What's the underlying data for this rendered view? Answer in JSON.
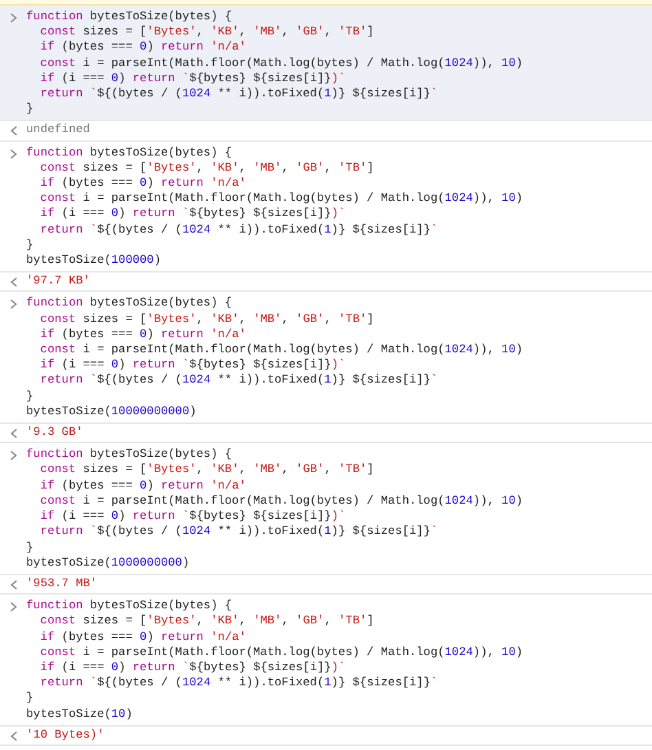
{
  "console": [
    {
      "input": {
        "selected": true,
        "lines": [
          {
            "indented": false,
            "tokens": [
              {
                "kind": "keyword",
                "text": "function"
              },
              {
                "kind": "plain",
                "text": " bytesToSize(bytes) {"
              }
            ]
          },
          {
            "indented": true,
            "tokens": [
              {
                "kind": "keyword",
                "text": "const"
              },
              {
                "kind": "plain",
                "text": " sizes = ["
              },
              {
                "kind": "string",
                "text": "'Bytes'"
              },
              {
                "kind": "plain",
                "text": ", "
              },
              {
                "kind": "string",
                "text": "'KB'"
              },
              {
                "kind": "plain",
                "text": ", "
              },
              {
                "kind": "string",
                "text": "'MB'"
              },
              {
                "kind": "plain",
                "text": ", "
              },
              {
                "kind": "string",
                "text": "'GB'"
              },
              {
                "kind": "plain",
                "text": ", "
              },
              {
                "kind": "string",
                "text": "'TB'"
              },
              {
                "kind": "plain",
                "text": "]"
              }
            ]
          },
          {
            "indented": true,
            "tokens": [
              {
                "kind": "keyword",
                "text": "if"
              },
              {
                "kind": "plain",
                "text": " (bytes === "
              },
              {
                "kind": "number",
                "text": "0"
              },
              {
                "kind": "plain",
                "text": ") "
              },
              {
                "kind": "keyword",
                "text": "return"
              },
              {
                "kind": "string",
                "text": " 'n/a'"
              }
            ]
          },
          {
            "indented": true,
            "tokens": [
              {
                "kind": "keyword",
                "text": "const"
              },
              {
                "kind": "plain",
                "text": " i = parseInt(Math.floor(Math.log(bytes) / Math.log("
              },
              {
                "kind": "number",
                "text": "1024"
              },
              {
                "kind": "plain",
                "text": ")), "
              },
              {
                "kind": "number",
                "text": "10"
              },
              {
                "kind": "plain",
                "text": ")"
              }
            ]
          },
          {
            "indented": true,
            "tokens": [
              {
                "kind": "keyword",
                "text": "if"
              },
              {
                "kind": "plain",
                "text": " (i === "
              },
              {
                "kind": "number",
                "text": "0"
              },
              {
                "kind": "plain",
                "text": ") "
              },
              {
                "kind": "keyword",
                "text": "return"
              },
              {
                "kind": "string",
                "text": " `"
              },
              {
                "kind": "plain",
                "text": "${bytes} ${sizes[i]}"
              },
              {
                "kind": "string",
                "text": ")`"
              }
            ]
          },
          {
            "indented": true,
            "tokens": [
              {
                "kind": "keyword",
                "text": "return"
              },
              {
                "kind": "string",
                "text": " `"
              },
              {
                "kind": "plain",
                "text": "${(bytes / ("
              },
              {
                "kind": "number",
                "text": "1024"
              },
              {
                "kind": "plain",
                "text": " ** i)).toFixed("
              },
              {
                "kind": "number",
                "text": "1"
              },
              {
                "kind": "plain",
                "text": ")} ${sizes[i]}"
              },
              {
                "kind": "string",
                "text": "`"
              }
            ]
          },
          {
            "indented": false,
            "tokens": [
              {
                "kind": "plain",
                "text": "}"
              }
            ]
          }
        ]
      },
      "output": {
        "kind": "undefined",
        "text": "undefined"
      }
    },
    {
      "input": {
        "selected": false,
        "lines": [
          {
            "indented": false,
            "tokens": [
              {
                "kind": "keyword",
                "text": "function"
              },
              {
                "kind": "plain",
                "text": " bytesToSize(bytes) {"
              }
            ]
          },
          {
            "indented": true,
            "tokens": [
              {
                "kind": "keyword",
                "text": "const"
              },
              {
                "kind": "plain",
                "text": " sizes = ["
              },
              {
                "kind": "string",
                "text": "'Bytes'"
              },
              {
                "kind": "plain",
                "text": ", "
              },
              {
                "kind": "string",
                "text": "'KB'"
              },
              {
                "kind": "plain",
                "text": ", "
              },
              {
                "kind": "string",
                "text": "'MB'"
              },
              {
                "kind": "plain",
                "text": ", "
              },
              {
                "kind": "string",
                "text": "'GB'"
              },
              {
                "kind": "plain",
                "text": ", "
              },
              {
                "kind": "string",
                "text": "'TB'"
              },
              {
                "kind": "plain",
                "text": "]"
              }
            ]
          },
          {
            "indented": true,
            "tokens": [
              {
                "kind": "keyword",
                "text": "if"
              },
              {
                "kind": "plain",
                "text": " (bytes === "
              },
              {
                "kind": "number",
                "text": "0"
              },
              {
                "kind": "plain",
                "text": ") "
              },
              {
                "kind": "keyword",
                "text": "return"
              },
              {
                "kind": "string",
                "text": " 'n/a'"
              }
            ]
          },
          {
            "indented": true,
            "tokens": [
              {
                "kind": "keyword",
                "text": "const"
              },
              {
                "kind": "plain",
                "text": " i = parseInt(Math.floor(Math.log(bytes) / Math.log("
              },
              {
                "kind": "number",
                "text": "1024"
              },
              {
                "kind": "plain",
                "text": ")), "
              },
              {
                "kind": "number",
                "text": "10"
              },
              {
                "kind": "plain",
                "text": ")"
              }
            ]
          },
          {
            "indented": true,
            "tokens": [
              {
                "kind": "keyword",
                "text": "if"
              },
              {
                "kind": "plain",
                "text": " (i === "
              },
              {
                "kind": "number",
                "text": "0"
              },
              {
                "kind": "plain",
                "text": ") "
              },
              {
                "kind": "keyword",
                "text": "return"
              },
              {
                "kind": "string",
                "text": " `"
              },
              {
                "kind": "plain",
                "text": "${bytes} ${sizes[i]}"
              },
              {
                "kind": "string",
                "text": ")`"
              }
            ]
          },
          {
            "indented": true,
            "tokens": [
              {
                "kind": "keyword",
                "text": "return"
              },
              {
                "kind": "string",
                "text": " `"
              },
              {
                "kind": "plain",
                "text": "${(bytes / ("
              },
              {
                "kind": "number",
                "text": "1024"
              },
              {
                "kind": "plain",
                "text": " ** i)).toFixed("
              },
              {
                "kind": "number",
                "text": "1"
              },
              {
                "kind": "plain",
                "text": ")} ${sizes[i]}"
              },
              {
                "kind": "string",
                "text": "`"
              }
            ]
          },
          {
            "indented": false,
            "tokens": [
              {
                "kind": "plain",
                "text": "}"
              }
            ]
          },
          {
            "indented": false,
            "tokens": [
              {
                "kind": "plain",
                "text": "bytesToSize("
              },
              {
                "kind": "number",
                "text": "100000"
              },
              {
                "kind": "plain",
                "text": ")"
              }
            ]
          }
        ]
      },
      "output": {
        "kind": "string",
        "text": "'97.7 KB'"
      }
    },
    {
      "input": {
        "selected": false,
        "lines": [
          {
            "indented": false,
            "tokens": [
              {
                "kind": "keyword",
                "text": "function"
              },
              {
                "kind": "plain",
                "text": " bytesToSize(bytes) {"
              }
            ]
          },
          {
            "indented": true,
            "tokens": [
              {
                "kind": "keyword",
                "text": "const"
              },
              {
                "kind": "plain",
                "text": " sizes = ["
              },
              {
                "kind": "string",
                "text": "'Bytes'"
              },
              {
                "kind": "plain",
                "text": ", "
              },
              {
                "kind": "string",
                "text": "'KB'"
              },
              {
                "kind": "plain",
                "text": ", "
              },
              {
                "kind": "string",
                "text": "'MB'"
              },
              {
                "kind": "plain",
                "text": ", "
              },
              {
                "kind": "string",
                "text": "'GB'"
              },
              {
                "kind": "plain",
                "text": ", "
              },
              {
                "kind": "string",
                "text": "'TB'"
              },
              {
                "kind": "plain",
                "text": "]"
              }
            ]
          },
          {
            "indented": true,
            "tokens": [
              {
                "kind": "keyword",
                "text": "if"
              },
              {
                "kind": "plain",
                "text": " (bytes === "
              },
              {
                "kind": "number",
                "text": "0"
              },
              {
                "kind": "plain",
                "text": ") "
              },
              {
                "kind": "keyword",
                "text": "return"
              },
              {
                "kind": "string",
                "text": " 'n/a'"
              }
            ]
          },
          {
            "indented": true,
            "tokens": [
              {
                "kind": "keyword",
                "text": "const"
              },
              {
                "kind": "plain",
                "text": " i = parseInt(Math.floor(Math.log(bytes) / Math.log("
              },
              {
                "kind": "number",
                "text": "1024"
              },
              {
                "kind": "plain",
                "text": ")), "
              },
              {
                "kind": "number",
                "text": "10"
              },
              {
                "kind": "plain",
                "text": ")"
              }
            ]
          },
          {
            "indented": true,
            "tokens": [
              {
                "kind": "keyword",
                "text": "if"
              },
              {
                "kind": "plain",
                "text": " (i === "
              },
              {
                "kind": "number",
                "text": "0"
              },
              {
                "kind": "plain",
                "text": ") "
              },
              {
                "kind": "keyword",
                "text": "return"
              },
              {
                "kind": "string",
                "text": " `"
              },
              {
                "kind": "plain",
                "text": "${bytes} ${sizes[i]}"
              },
              {
                "kind": "string",
                "text": ")`"
              }
            ]
          },
          {
            "indented": true,
            "tokens": [
              {
                "kind": "keyword",
                "text": "return"
              },
              {
                "kind": "string",
                "text": " `"
              },
              {
                "kind": "plain",
                "text": "${(bytes / ("
              },
              {
                "kind": "number",
                "text": "1024"
              },
              {
                "kind": "plain",
                "text": " ** i)).toFixed("
              },
              {
                "kind": "number",
                "text": "1"
              },
              {
                "kind": "plain",
                "text": ")} ${sizes[i]}"
              },
              {
                "kind": "string",
                "text": "`"
              }
            ]
          },
          {
            "indented": false,
            "tokens": [
              {
                "kind": "plain",
                "text": "}"
              }
            ]
          },
          {
            "indented": false,
            "tokens": [
              {
                "kind": "plain",
                "text": "bytesToSize("
              },
              {
                "kind": "number",
                "text": "10000000000"
              },
              {
                "kind": "plain",
                "text": ")"
              }
            ]
          }
        ]
      },
      "output": {
        "kind": "string",
        "text": "'9.3 GB'"
      }
    },
    {
      "input": {
        "selected": false,
        "lines": [
          {
            "indented": false,
            "tokens": [
              {
                "kind": "keyword",
                "text": "function"
              },
              {
                "kind": "plain",
                "text": " bytesToSize(bytes) {"
              }
            ]
          },
          {
            "indented": true,
            "tokens": [
              {
                "kind": "keyword",
                "text": "const"
              },
              {
                "kind": "plain",
                "text": " sizes = ["
              },
              {
                "kind": "string",
                "text": "'Bytes'"
              },
              {
                "kind": "plain",
                "text": ", "
              },
              {
                "kind": "string",
                "text": "'KB'"
              },
              {
                "kind": "plain",
                "text": ", "
              },
              {
                "kind": "string",
                "text": "'MB'"
              },
              {
                "kind": "plain",
                "text": ", "
              },
              {
                "kind": "string",
                "text": "'GB'"
              },
              {
                "kind": "plain",
                "text": ", "
              },
              {
                "kind": "string",
                "text": "'TB'"
              },
              {
                "kind": "plain",
                "text": "]"
              }
            ]
          },
          {
            "indented": true,
            "tokens": [
              {
                "kind": "keyword",
                "text": "if"
              },
              {
                "kind": "plain",
                "text": " (bytes === "
              },
              {
                "kind": "number",
                "text": "0"
              },
              {
                "kind": "plain",
                "text": ") "
              },
              {
                "kind": "keyword",
                "text": "return"
              },
              {
                "kind": "string",
                "text": " 'n/a'"
              }
            ]
          },
          {
            "indented": true,
            "tokens": [
              {
                "kind": "keyword",
                "text": "const"
              },
              {
                "kind": "plain",
                "text": " i = parseInt(Math.floor(Math.log(bytes) / Math.log("
              },
              {
                "kind": "number",
                "text": "1024"
              },
              {
                "kind": "plain",
                "text": ")), "
              },
              {
                "kind": "number",
                "text": "10"
              },
              {
                "kind": "plain",
                "text": ")"
              }
            ]
          },
          {
            "indented": true,
            "tokens": [
              {
                "kind": "keyword",
                "text": "if"
              },
              {
                "kind": "plain",
                "text": " (i === "
              },
              {
                "kind": "number",
                "text": "0"
              },
              {
                "kind": "plain",
                "text": ") "
              },
              {
                "kind": "keyword",
                "text": "return"
              },
              {
                "kind": "string",
                "text": " `"
              },
              {
                "kind": "plain",
                "text": "${bytes} ${sizes[i]}"
              },
              {
                "kind": "string",
                "text": ")`"
              }
            ]
          },
          {
            "indented": true,
            "tokens": [
              {
                "kind": "keyword",
                "text": "return"
              },
              {
                "kind": "string",
                "text": " `"
              },
              {
                "kind": "plain",
                "text": "${(bytes / ("
              },
              {
                "kind": "number",
                "text": "1024"
              },
              {
                "kind": "plain",
                "text": " ** i)).toFixed("
              },
              {
                "kind": "number",
                "text": "1"
              },
              {
                "kind": "plain",
                "text": ")} ${sizes[i]}"
              },
              {
                "kind": "string",
                "text": "`"
              }
            ]
          },
          {
            "indented": false,
            "tokens": [
              {
                "kind": "plain",
                "text": "}"
              }
            ]
          },
          {
            "indented": false,
            "tokens": [
              {
                "kind": "plain",
                "text": "bytesToSize("
              },
              {
                "kind": "number",
                "text": "1000000000"
              },
              {
                "kind": "plain",
                "text": ")"
              }
            ]
          }
        ]
      },
      "output": {
        "kind": "string",
        "text": "'953.7 MB'"
      }
    },
    {
      "input": {
        "selected": false,
        "lines": [
          {
            "indented": false,
            "tokens": [
              {
                "kind": "keyword",
                "text": "function"
              },
              {
                "kind": "plain",
                "text": " bytesToSize(bytes) {"
              }
            ]
          },
          {
            "indented": true,
            "tokens": [
              {
                "kind": "keyword",
                "text": "const"
              },
              {
                "kind": "plain",
                "text": " sizes = ["
              },
              {
                "kind": "string",
                "text": "'Bytes'"
              },
              {
                "kind": "plain",
                "text": ", "
              },
              {
                "kind": "string",
                "text": "'KB'"
              },
              {
                "kind": "plain",
                "text": ", "
              },
              {
                "kind": "string",
                "text": "'MB'"
              },
              {
                "kind": "plain",
                "text": ", "
              },
              {
                "kind": "string",
                "text": "'GB'"
              },
              {
                "kind": "plain",
                "text": ", "
              },
              {
                "kind": "string",
                "text": "'TB'"
              },
              {
                "kind": "plain",
                "text": "]"
              }
            ]
          },
          {
            "indented": true,
            "tokens": [
              {
                "kind": "keyword",
                "text": "if"
              },
              {
                "kind": "plain",
                "text": " (bytes === "
              },
              {
                "kind": "number",
                "text": "0"
              },
              {
                "kind": "plain",
                "text": ") "
              },
              {
                "kind": "keyword",
                "text": "return"
              },
              {
                "kind": "string",
                "text": " 'n/a'"
              }
            ]
          },
          {
            "indented": true,
            "tokens": [
              {
                "kind": "keyword",
                "text": "const"
              },
              {
                "kind": "plain",
                "text": " i = parseInt(Math.floor(Math.log(bytes) / Math.log("
              },
              {
                "kind": "number",
                "text": "1024"
              },
              {
                "kind": "plain",
                "text": ")), "
              },
              {
                "kind": "number",
                "text": "10"
              },
              {
                "kind": "plain",
                "text": ")"
              }
            ]
          },
          {
            "indented": true,
            "tokens": [
              {
                "kind": "keyword",
                "text": "if"
              },
              {
                "kind": "plain",
                "text": " (i === "
              },
              {
                "kind": "number",
                "text": "0"
              },
              {
                "kind": "plain",
                "text": ") "
              },
              {
                "kind": "keyword",
                "text": "return"
              },
              {
                "kind": "string",
                "text": " `"
              },
              {
                "kind": "plain",
                "text": "${bytes} ${sizes[i]}"
              },
              {
                "kind": "string",
                "text": ")`"
              }
            ]
          },
          {
            "indented": true,
            "tokens": [
              {
                "kind": "keyword",
                "text": "return"
              },
              {
                "kind": "string",
                "text": " `"
              },
              {
                "kind": "plain",
                "text": "${(bytes / ("
              },
              {
                "kind": "number",
                "text": "1024"
              },
              {
                "kind": "plain",
                "text": " ** i)).toFixed("
              },
              {
                "kind": "number",
                "text": "1"
              },
              {
                "kind": "plain",
                "text": ")} ${sizes[i]}"
              },
              {
                "kind": "string",
                "text": "`"
              }
            ]
          },
          {
            "indented": false,
            "tokens": [
              {
                "kind": "plain",
                "text": "}"
              }
            ]
          },
          {
            "indented": false,
            "tokens": [
              {
                "kind": "plain",
                "text": "bytesToSize("
              },
              {
                "kind": "number",
                "text": "10"
              },
              {
                "kind": "plain",
                "text": ")"
              }
            ]
          }
        ]
      },
      "output": {
        "kind": "string",
        "text": "'10 Bytes)'"
      }
    }
  ]
}
